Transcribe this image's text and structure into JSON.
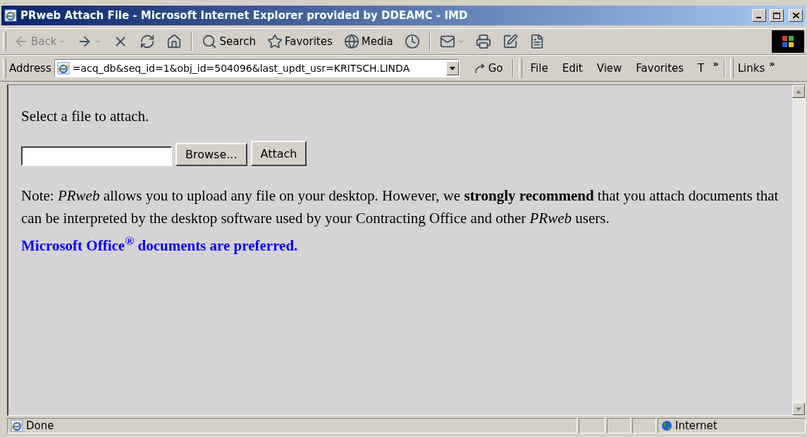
{
  "window": {
    "title": "PRweb Attach File - Microsoft Internet Explorer provided by DDEAMC - IMD"
  },
  "toolbar": {
    "buttons": [
      {
        "kind": "back",
        "label": "Back",
        "disabled": true,
        "dropdown": true
      },
      {
        "kind": "forward",
        "disabled": false,
        "dropdown": true
      },
      {
        "kind": "stop",
        "disabled": false,
        "dropdown": false
      },
      {
        "kind": "refresh",
        "disabled": false,
        "dropdown": false
      },
      {
        "kind": "home",
        "disabled": false,
        "dropdown": false
      },
      {
        "kind": "separator"
      },
      {
        "kind": "search",
        "label": "Search",
        "disabled": false,
        "dropdown": false
      },
      {
        "kind": "favorites",
        "label": "Favorites",
        "disabled": false,
        "dropdown": false
      },
      {
        "kind": "media",
        "label": "Media",
        "disabled": false,
        "dropdown": false
      },
      {
        "kind": "history",
        "disabled": false,
        "dropdown": false
      },
      {
        "kind": "separator"
      },
      {
        "kind": "mail",
        "disabled": false,
        "dropdown": true
      },
      {
        "kind": "print",
        "disabled": false,
        "dropdown": false
      },
      {
        "kind": "edit",
        "disabled": false,
        "dropdown": false
      },
      {
        "kind": "discuss",
        "disabled": false,
        "dropdown": false
      }
    ]
  },
  "address_bar": {
    "label": "Address",
    "value": "=acq_db&seq_id=1&obj_id=504096&last_updt_usr=KRITSCH.LINDA",
    "go": "Go"
  },
  "menu": {
    "items": [
      "File",
      "Edit",
      "View",
      "Favorites",
      "T"
    ],
    "more": "»"
  },
  "links": {
    "label": "Links",
    "more": "»"
  },
  "page": {
    "prompt": "Select a file to attach.",
    "browse_button": "Browse...",
    "attach_button": "Attach",
    "note": "Note: *PRweb* allows you to upload any file on your desktop. However, we **strongly recommend** that you attach documents that can be interpreted by the desktop software used by your Contracting Office and other *PRweb* users.",
    "highlight": "Microsoft Office$^{®}$ documents are preferred."
  },
  "status_bar": {
    "text": "Done",
    "zone": "Internet"
  }
}
